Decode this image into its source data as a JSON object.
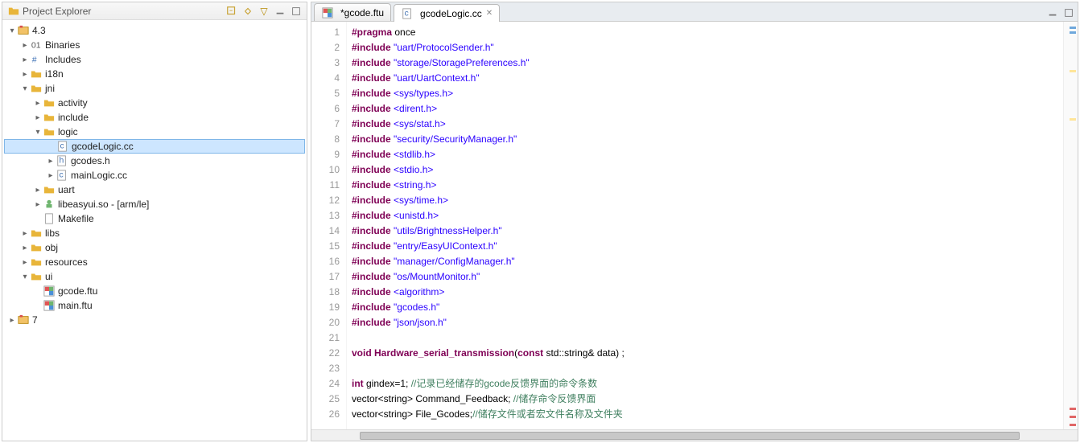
{
  "explorer": {
    "title": "Project Explorer",
    "tree": [
      {
        "ind": 0,
        "twisty": "▾",
        "icon": "proj",
        "label": "4.3"
      },
      {
        "ind": 1,
        "twisty": "▸",
        "icon": "bin",
        "label": "Binaries"
      },
      {
        "ind": 1,
        "twisty": "▸",
        "icon": "inc",
        "label": "Includes"
      },
      {
        "ind": 1,
        "twisty": "▸",
        "icon": "folder",
        "label": "i18n"
      },
      {
        "ind": 1,
        "twisty": "▾",
        "icon": "folder",
        "label": "jni"
      },
      {
        "ind": 2,
        "twisty": "▸",
        "icon": "folder",
        "label": "activity"
      },
      {
        "ind": 2,
        "twisty": "▸",
        "icon": "folder",
        "label": "include"
      },
      {
        "ind": 2,
        "twisty": "▾",
        "icon": "folder",
        "label": "logic"
      },
      {
        "ind": 3,
        "twisty": "",
        "icon": "cfile",
        "label": "gcodeLogic.cc",
        "selected": true
      },
      {
        "ind": 3,
        "twisty": "▸",
        "icon": "hfile",
        "label": "gcodes.h"
      },
      {
        "ind": 3,
        "twisty": "▸",
        "icon": "cfile",
        "label": "mainLogic.cc"
      },
      {
        "ind": 2,
        "twisty": "▸",
        "icon": "folder",
        "label": "uart"
      },
      {
        "ind": 2,
        "twisty": "▸",
        "icon": "lib",
        "label": "libeasyui.so - [arm/le]"
      },
      {
        "ind": 2,
        "twisty": "",
        "icon": "file",
        "label": "Makefile"
      },
      {
        "ind": 1,
        "twisty": "▸",
        "icon": "folder",
        "label": "libs"
      },
      {
        "ind": 1,
        "twisty": "▸",
        "icon": "folder",
        "label": "obj"
      },
      {
        "ind": 1,
        "twisty": "▸",
        "icon": "folder",
        "label": "resources"
      },
      {
        "ind": 1,
        "twisty": "▾",
        "icon": "folder",
        "label": "ui"
      },
      {
        "ind": 2,
        "twisty": "",
        "icon": "ftu",
        "label": "gcode.ftu"
      },
      {
        "ind": 2,
        "twisty": "",
        "icon": "ftu",
        "label": "main.ftu"
      },
      {
        "ind": 0,
        "twisty": "▸",
        "icon": "proj",
        "label": "7"
      }
    ]
  },
  "editor": {
    "tabs": [
      {
        "icon": "ftu",
        "label": "*gcode.ftu",
        "active": false,
        "closeable": false
      },
      {
        "icon": "cfile",
        "label": "gcodeLogic.cc",
        "active": true,
        "closeable": true
      }
    ],
    "lines": [
      [
        {
          "c": "kw",
          "t": "#pragma"
        },
        {
          "c": "txt",
          "t": " once"
        }
      ],
      [
        {
          "c": "kw",
          "t": "#include"
        },
        {
          "c": "txt",
          "t": " "
        },
        {
          "c": "str",
          "t": "\"uart/ProtocolSender.h\""
        }
      ],
      [
        {
          "c": "kw",
          "t": "#include"
        },
        {
          "c": "txt",
          "t": " "
        },
        {
          "c": "str",
          "t": "\"storage/StoragePreferences.h\""
        }
      ],
      [
        {
          "c": "kw",
          "t": "#include"
        },
        {
          "c": "txt",
          "t": " "
        },
        {
          "c": "str",
          "t": "\"uart/UartContext.h\""
        }
      ],
      [
        {
          "c": "kw",
          "t": "#include"
        },
        {
          "c": "txt",
          "t": " "
        },
        {
          "c": "str",
          "t": "<sys/types.h>"
        }
      ],
      [
        {
          "c": "kw",
          "t": "#include"
        },
        {
          "c": "txt",
          "t": " "
        },
        {
          "c": "str",
          "t": "<dirent.h>"
        }
      ],
      [
        {
          "c": "kw",
          "t": "#include"
        },
        {
          "c": "txt",
          "t": " "
        },
        {
          "c": "str",
          "t": "<sys/stat.h>"
        }
      ],
      [
        {
          "c": "kw",
          "t": "#include"
        },
        {
          "c": "txt",
          "t": " "
        },
        {
          "c": "str",
          "t": "\"security/SecurityManager.h\""
        }
      ],
      [
        {
          "c": "kw",
          "t": "#include"
        },
        {
          "c": "txt",
          "t": " "
        },
        {
          "c": "str",
          "t": "<stdlib.h>"
        }
      ],
      [
        {
          "c": "kw",
          "t": "#include"
        },
        {
          "c": "txt",
          "t": " "
        },
        {
          "c": "str",
          "t": "<stdio.h>"
        }
      ],
      [
        {
          "c": "kw",
          "t": "#include"
        },
        {
          "c": "txt",
          "t": " "
        },
        {
          "c": "str",
          "t": "<string.h>"
        }
      ],
      [
        {
          "c": "kw",
          "t": "#include"
        },
        {
          "c": "txt",
          "t": " "
        },
        {
          "c": "str",
          "t": "<sys/time.h>"
        }
      ],
      [
        {
          "c": "kw",
          "t": "#include"
        },
        {
          "c": "txt",
          "t": " "
        },
        {
          "c": "str",
          "t": "<unistd.h>"
        }
      ],
      [
        {
          "c": "kw",
          "t": "#include"
        },
        {
          "c": "txt",
          "t": " "
        },
        {
          "c": "str",
          "t": "\"utils/BrightnessHelper.h\""
        }
      ],
      [
        {
          "c": "kw",
          "t": "#include"
        },
        {
          "c": "txt",
          "t": " "
        },
        {
          "c": "str",
          "t": "\"entry/EasyUIContext.h\""
        }
      ],
      [
        {
          "c": "kw",
          "t": "#include"
        },
        {
          "c": "txt",
          "t": " "
        },
        {
          "c": "str",
          "t": "\"manager/ConfigManager.h\""
        }
      ],
      [
        {
          "c": "kw",
          "t": "#include"
        },
        {
          "c": "txt",
          "t": " "
        },
        {
          "c": "str",
          "t": "\"os/MountMonitor.h\""
        }
      ],
      [
        {
          "c": "kw",
          "t": "#include"
        },
        {
          "c": "txt",
          "t": " "
        },
        {
          "c": "str",
          "t": "<algorithm>"
        }
      ],
      [
        {
          "c": "kw",
          "t": "#include"
        },
        {
          "c": "txt",
          "t": " "
        },
        {
          "c": "str",
          "t": "\"gcodes.h\""
        }
      ],
      [
        {
          "c": "kw",
          "t": "#include"
        },
        {
          "c": "txt",
          "t": " "
        },
        {
          "c": "str",
          "t": "\"json/json.h\""
        }
      ],
      [],
      [
        {
          "c": "kw",
          "t": "void"
        },
        {
          "c": "txt",
          "t": " "
        },
        {
          "c": "kw",
          "t": "Hardware_serial_transmission"
        },
        {
          "c": "txt",
          "t": "("
        },
        {
          "c": "kw",
          "t": "const"
        },
        {
          "c": "txt",
          "t": " std::string& data) ;"
        }
      ],
      [],
      [
        {
          "c": "kw",
          "t": "int"
        },
        {
          "c": "txt",
          "t": " gindex=1; "
        },
        {
          "c": "cm",
          "t": "//记录已经储存的gcode反馈界面的命令条数"
        }
      ],
      [
        {
          "c": "txt",
          "t": "vector<string> Command_Feedback; "
        },
        {
          "c": "cm",
          "t": "//储存命令反馈界面"
        }
      ],
      [
        {
          "c": "txt",
          "t": "vector<string> File_Gcodes;"
        },
        {
          "c": "cm",
          "t": "//储存文件或者宏文件名称及文件夹"
        }
      ]
    ]
  }
}
